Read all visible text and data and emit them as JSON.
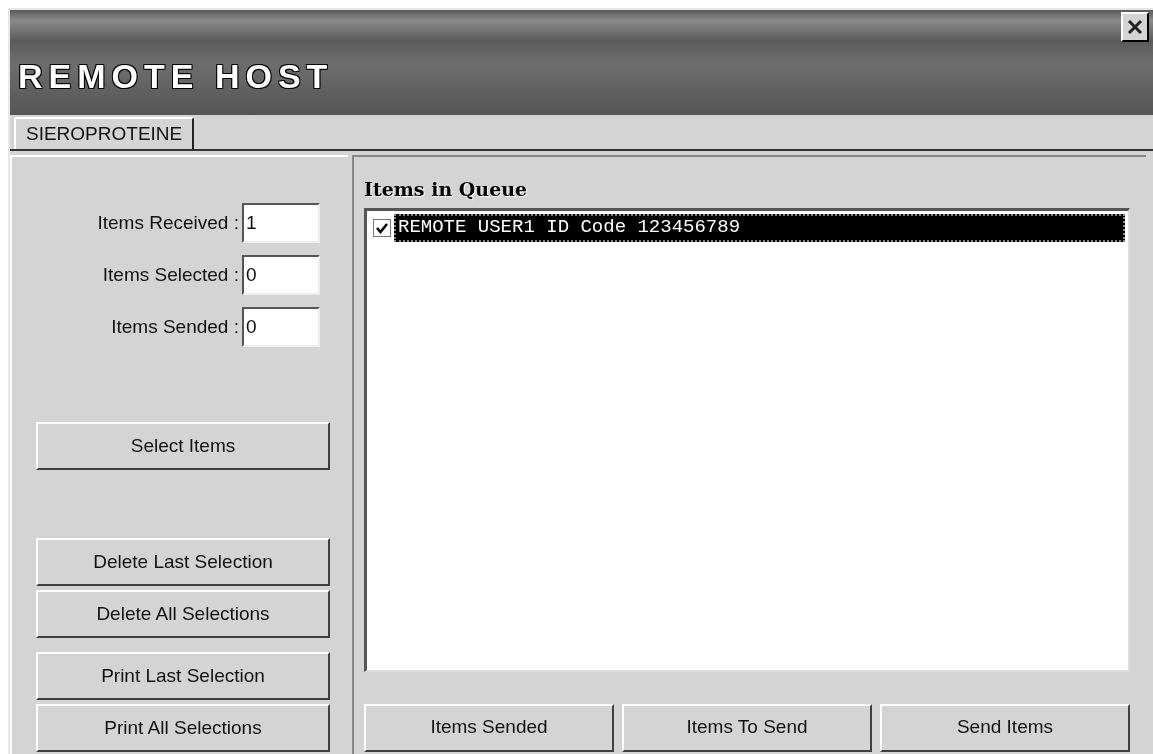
{
  "window": {
    "title": "REMOTE HOST"
  },
  "tabs": [
    {
      "label": "SIEROPROTEINE",
      "selected": true
    }
  ],
  "counters": [
    {
      "label": "Items Received :",
      "value": "1"
    },
    {
      "label": "Items Selected :",
      "value": "0"
    },
    {
      "label": "Items Sended :",
      "value": "0"
    }
  ],
  "left_button_groups": [
    [
      "Select Items"
    ],
    [
      "Delete Last Selection",
      "Delete All Selections"
    ],
    [
      "Print Last Selection",
      "Print All Selections"
    ]
  ],
  "queue": {
    "title": "Items in Queue",
    "items": [
      {
        "text": "REMOTE USER1 ID Code 123456789",
        "checked": true,
        "selected": true
      }
    ]
  },
  "bottom_buttons": [
    "Items Sended",
    "Items To Send",
    "Send Items"
  ]
}
